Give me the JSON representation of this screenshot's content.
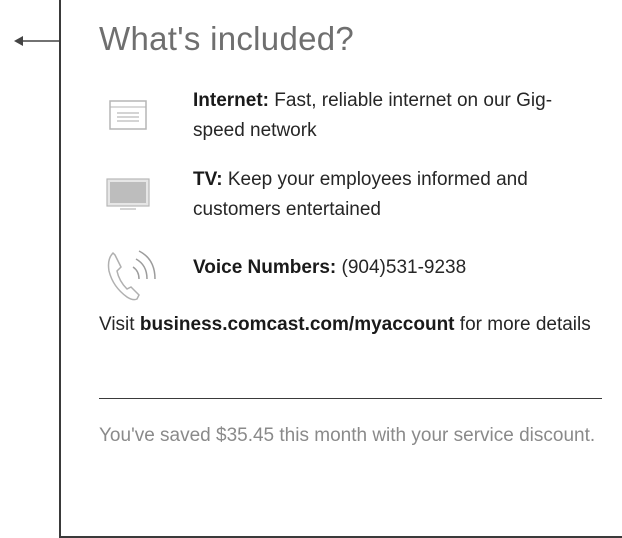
{
  "title": "What's included?",
  "items": [
    {
      "icon": "internet-icon",
      "label": "Internet:",
      "desc": "Fast, reliable internet on our Gig-speed network"
    },
    {
      "icon": "tv-icon",
      "label": "TV:",
      "desc": "Keep your employees informed and customers entertained"
    },
    {
      "icon": "phone-icon",
      "label": "Voice Numbers:",
      "desc": "(904)531-9238"
    }
  ],
  "visit": {
    "prefix": "Visit",
    "link": "business.comcast.com/myaccount",
    "suffix": "for more details"
  },
  "savings": "You've saved $35.45 this month with your service discount."
}
